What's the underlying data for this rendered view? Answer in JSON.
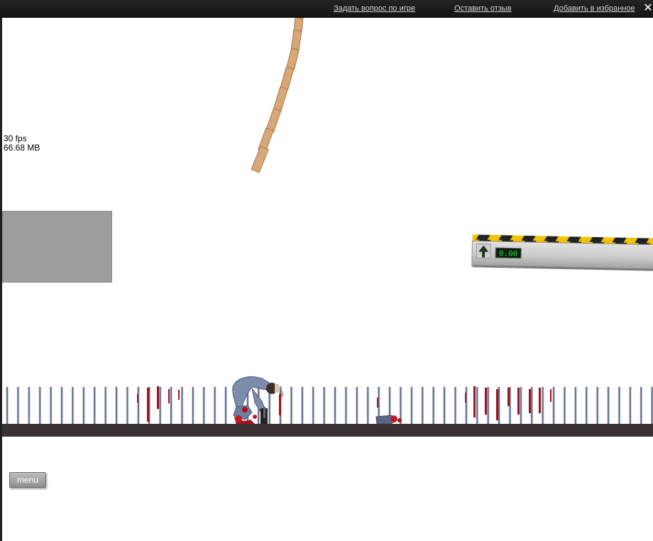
{
  "topbar": {
    "links": [
      {
        "label": "Задать вопрос по игре"
      },
      {
        "label": "Оставить отзыв"
      },
      {
        "label": "Добавить в избранное"
      }
    ],
    "close_label": "✕"
  },
  "stats": {
    "fps": "30 fps",
    "memory": "66.68 MB"
  },
  "elevator": {
    "display_value": "0.00",
    "arrow_icon": "up-arrow-icon"
  },
  "menu_button": {
    "label": "menu"
  },
  "colors": {
    "ground": "#3a3132",
    "wood": "#d7a877",
    "hazard_yellow": "#f2c200",
    "blood": "#a3121a",
    "display_green": "#2fe03a"
  }
}
